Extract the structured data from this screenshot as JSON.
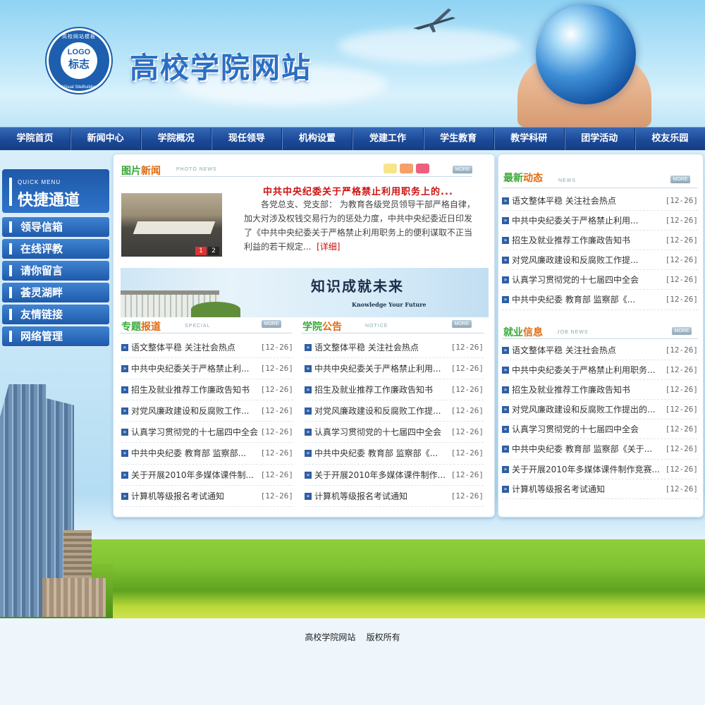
{
  "header": {
    "site_title": "高校学院网站",
    "logo": {
      "ring_text": "高校网站模板",
      "word": "LOGO",
      "cn": "标志",
      "ring_bottom": "Visual SiteBuilder"
    }
  },
  "nav": [
    "学院首页",
    "新闻中心",
    "学院概况",
    "现任领导",
    "机构设置",
    "党建工作",
    "学生教育",
    "教学科研",
    "团学活动",
    "校友乐园"
  ],
  "quick_menu": {
    "en": "QUICK MENU",
    "title": "快捷通道",
    "items": [
      "领导信箱",
      "在线评教",
      "请你留言",
      "荟灵湖畔",
      "友情链接",
      "网络管理"
    ]
  },
  "photo_news": {
    "title_a": "图片",
    "title_b": "新闻",
    "en": "PHOTO NEWS",
    "more": "MORE",
    "headline": "中共中央纪委关于严格禁止利用职务上的...",
    "summary": "各党总支、党支部： 为教育各级党员领导干部严格自律，加大对涉及权钱交易行为的惩处力度，中共中央纪委近日印发了《中共中央纪委关于严格禁止利用职务上的便利谋取不正当利益的若干规定...",
    "detail": "[详细]",
    "pages": [
      "1",
      "2"
    ],
    "dot_colors": [
      "#f6e58a",
      "#f5a06a",
      "#ee5f7e"
    ]
  },
  "banner": {
    "cn": "知识成就未来",
    "en": "Knowledge Your Future"
  },
  "special": {
    "title_a": "专题",
    "title_b": "报道",
    "en": "SPECIAL",
    "more": "MORE",
    "items": [
      {
        "t": "语文整体平稳  关注社会热点",
        "d": "[12-26]"
      },
      {
        "t": "中共中央纪委关于严格禁止利...",
        "d": "[12-26]"
      },
      {
        "t": "招生及就业推荐工作廉政告知书",
        "d": "[12-26]"
      },
      {
        "t": "对党风廉政建设和反腐败工作...",
        "d": "[12-26]"
      },
      {
        "t": "认真学习贯彻党的十七届四中全会",
        "d": "[12-26]"
      },
      {
        "t": "中共中央纪委  教育部  监察部...",
        "d": "[12-26]"
      },
      {
        "t": "关于开展2010年多媒体课件制...",
        "d": "[12-26]"
      },
      {
        "t": "计算机等级报名考试通知",
        "d": "[12-26]"
      }
    ]
  },
  "notice": {
    "title_a": "学院",
    "title_b": "公告",
    "en": "NOTICE",
    "more": "MORE",
    "items": [
      {
        "t": "语文整体平稳  关注社会热点",
        "d": "[12-26]"
      },
      {
        "t": "中共中央纪委关于严格禁止利用...",
        "d": "[12-26]"
      },
      {
        "t": "招生及就业推荐工作廉政告知书",
        "d": "[12-26]"
      },
      {
        "t": "对党风廉政建设和反腐败工作提...",
        "d": "[12-26]"
      },
      {
        "t": "认真学习贯彻党的十七届四中全会",
        "d": "[12-26]"
      },
      {
        "t": "中共中央纪委  教育部  监察部《...",
        "d": "[12-26]"
      },
      {
        "t": "关于开展2010年多媒体课件制作...",
        "d": "[12-26]"
      },
      {
        "t": "计算机等级报名考试通知",
        "d": "[12-26]"
      }
    ]
  },
  "latest": {
    "title_a": "最新",
    "title_b": "动态",
    "en": "NEWS",
    "more": "MORE",
    "items": [
      {
        "t": "语文整体平稳  关注社会热点",
        "d": "[12-26]"
      },
      {
        "t": "中共中央纪委关于严格禁止利用...",
        "d": "[12-26]"
      },
      {
        "t": "招生及就业推荐工作廉政告知书",
        "d": "[12-26]"
      },
      {
        "t": "对党风廉政建设和反腐败工作提...",
        "d": "[12-26]"
      },
      {
        "t": "认真学习贯彻党的十七届四中全会",
        "d": "[12-26]"
      },
      {
        "t": "中共中央纪委  教育部  监察部《...",
        "d": "[12-26]"
      }
    ]
  },
  "jobs": {
    "title_a": "就业",
    "title_b": "信息",
    "en": "JOB NEWS",
    "more": "MORE",
    "items": [
      {
        "t": "语文整体平稳  关注社会热点",
        "d": "[12-26]"
      },
      {
        "t": "中共中央纪委关于严格禁止利用职务...",
        "d": "[12-26]"
      },
      {
        "t": "招生及就业推荐工作廉政告知书",
        "d": "[12-26]"
      },
      {
        "t": "对党风廉政建设和反腐败工作提出的...",
        "d": "[12-26]"
      },
      {
        "t": "认真学习贯彻党的十七届四中全会",
        "d": "[12-26]"
      },
      {
        "t": "中共中央纪委  教育部  监察部《关于...",
        "d": "[12-26]"
      },
      {
        "t": "关于开展2010年多媒体课件制作竞赛...",
        "d": "[12-26]"
      },
      {
        "t": "计算机等级报名考试通知",
        "d": "[12-26]"
      }
    ]
  },
  "footer": {
    "text": "高校学院网站    版权所有"
  }
}
